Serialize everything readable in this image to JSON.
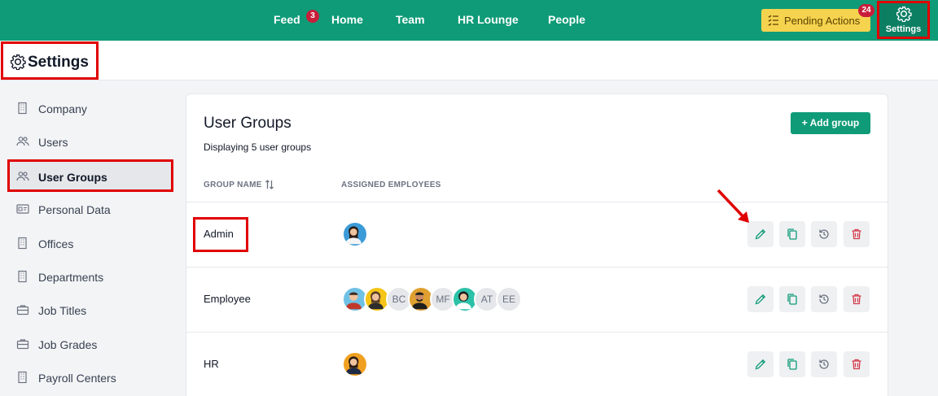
{
  "nav": {
    "items": [
      "Feed",
      "Home",
      "Team",
      "HR Lounge",
      "People"
    ],
    "feed_badge": "3",
    "pending_label": "Pending Actions",
    "pending_badge": "24",
    "settings_label": "Settings"
  },
  "header": {
    "title": "Settings"
  },
  "sidebar": {
    "items": [
      {
        "label": "Company",
        "icon": "building-icon"
      },
      {
        "label": "Users",
        "icon": "users-icon"
      },
      {
        "label": "User Groups",
        "icon": "users-icon"
      },
      {
        "label": "Personal Data",
        "icon": "id-card-icon"
      },
      {
        "label": "Offices",
        "icon": "building-icon"
      },
      {
        "label": "Departments",
        "icon": "building-icon"
      },
      {
        "label": "Job Titles",
        "icon": "briefcase-icon"
      },
      {
        "label": "Job Grades",
        "icon": "briefcase-icon"
      },
      {
        "label": "Payroll Centers",
        "icon": "building-icon"
      }
    ]
  },
  "card": {
    "title": "User Groups",
    "subtitle": "Displaying 5 user groups",
    "add_label": "+ Add group",
    "columns": [
      "GROUP NAME",
      "ASSIGNED EMPLOYEES"
    ],
    "rows": [
      {
        "name": "Admin",
        "initials": []
      },
      {
        "name": "Employee",
        "initials": [
          "BC",
          "MF",
          "AT",
          "EE"
        ]
      },
      {
        "name": "HR",
        "initials": []
      }
    ]
  },
  "colors": {
    "brand": "#0f9b78",
    "pending": "#f6d34f",
    "badge": "#c81e3a",
    "highlight": "#e00000"
  }
}
